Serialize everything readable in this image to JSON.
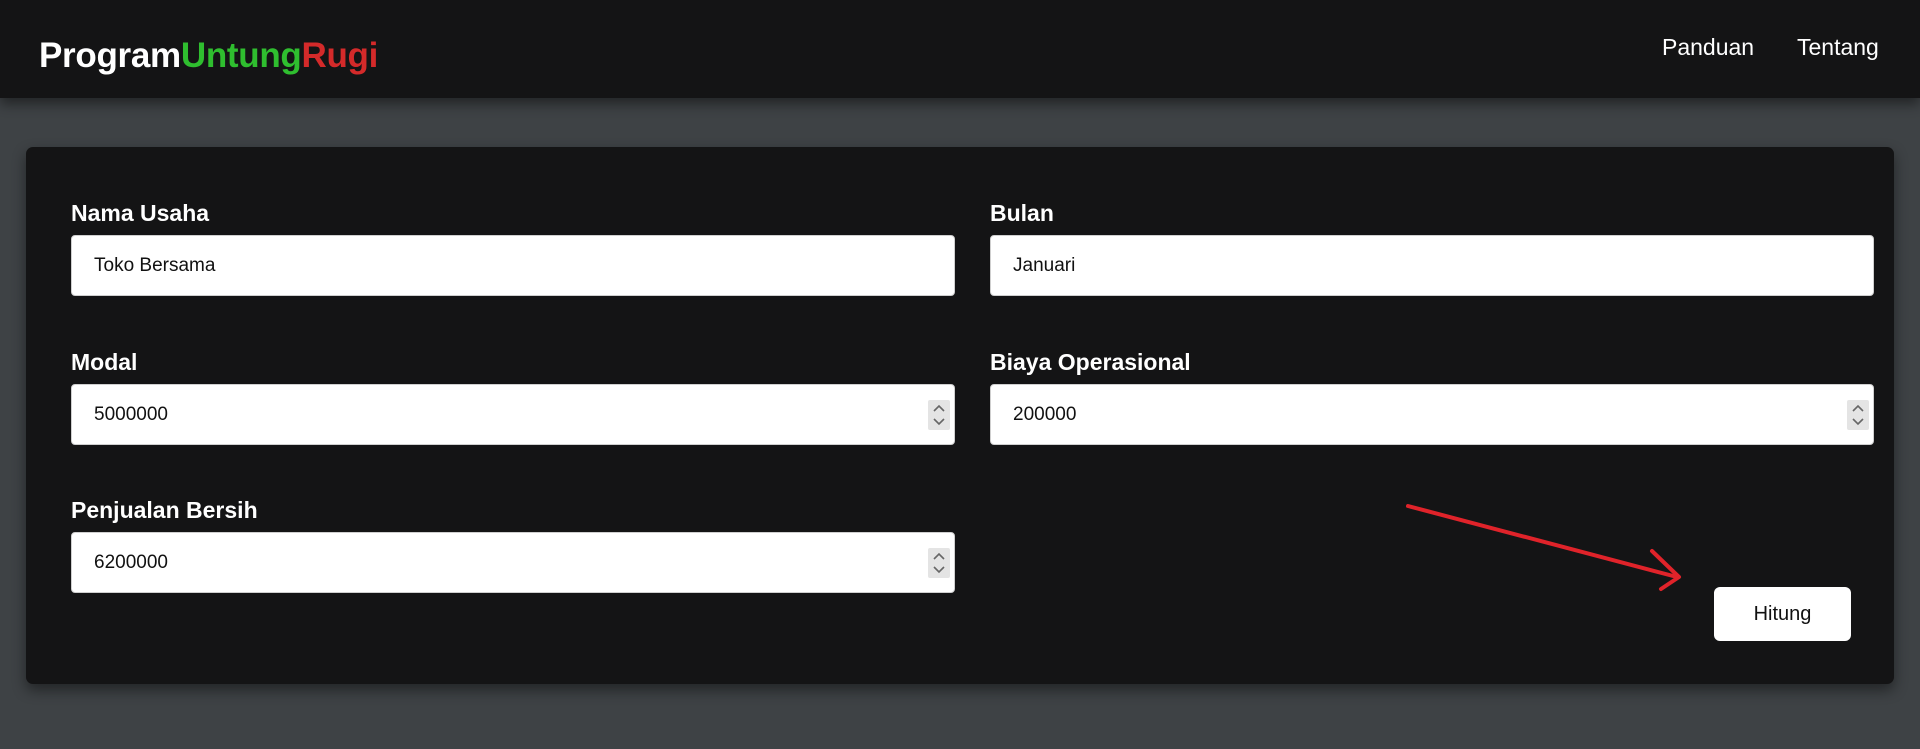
{
  "brand": {
    "part1": "Program",
    "part2": "Untung",
    "part3": "Rugi"
  },
  "nav": {
    "panduan": "Panduan",
    "tentang": "Tentang"
  },
  "form": {
    "nama_usaha": {
      "label": "Nama Usaha",
      "value": "Toko Bersama"
    },
    "bulan": {
      "label": "Bulan",
      "value": "Januari"
    },
    "modal": {
      "label": "Modal",
      "value": "5000000"
    },
    "biaya_operasional": {
      "label": "Biaya Operasional",
      "value": "200000"
    },
    "penjualan_bersih": {
      "label": "Penjualan Bersih",
      "value": "6200000"
    },
    "submit_label": "Hitung"
  },
  "colors": {
    "navbar_bg": "#141415",
    "page_bg": "#3e4245",
    "brand_untung": "#2fbe2f",
    "brand_rugi": "#d42a2a",
    "annotation_arrow": "#e0232a"
  },
  "icons": {
    "spinner": "up-down-chevron-icon",
    "annotation": "red-arrow-annotation-icon"
  }
}
